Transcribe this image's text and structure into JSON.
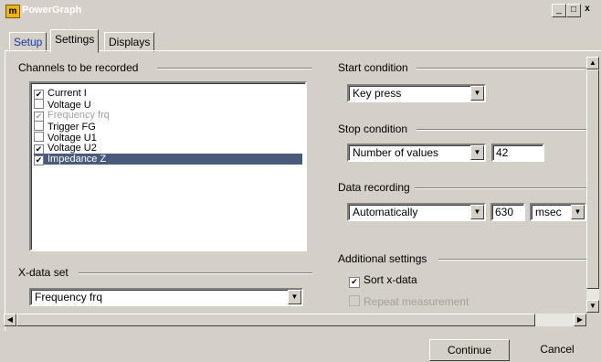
{
  "window": {
    "title": "PowerGraph",
    "logo": "m",
    "min": "_",
    "max": "□",
    "close": "x"
  },
  "tabs": [
    {
      "label": "Setup"
    },
    {
      "label": "Settings"
    },
    {
      "label": "Displays"
    }
  ],
  "channels": {
    "header": "Channels to be recorded",
    "items": [
      {
        "label": "Current I",
        "checked": true
      },
      {
        "label": "Voltage U",
        "checked": false
      },
      {
        "label": "Frequency frq",
        "checked": true,
        "disabled": true
      },
      {
        "label": "Trigger FG",
        "checked": false
      },
      {
        "label": "Voltage U1",
        "checked": false
      },
      {
        "label": "Voltage U2",
        "checked": true
      },
      {
        "label": "Impedance Z",
        "checked": true,
        "selected": true
      }
    ]
  },
  "xdata": {
    "header": "X-data set",
    "value": "Frequency frq"
  },
  "start": {
    "header": "Start condition",
    "value": "Key press"
  },
  "stop": {
    "header": "Stop condition",
    "value": "Number of values",
    "count": "42"
  },
  "recording": {
    "header": "Data recording",
    "value": "Automatically",
    "interval": "630",
    "unit": "msec"
  },
  "additional": {
    "header": "Additional settings",
    "sort_label": "Sort x-data",
    "sort_checked": true,
    "repeat_label": "Repeat measurement",
    "repeat_checked": false,
    "repeat_disabled": true
  },
  "footer": {
    "continue": "Continue",
    "cancel": "Cancel"
  },
  "icons": {
    "check": "✔",
    "arrow_down": "▼",
    "arrow_up": "▲",
    "arrow_left": "◀",
    "arrow_right": "▶"
  }
}
